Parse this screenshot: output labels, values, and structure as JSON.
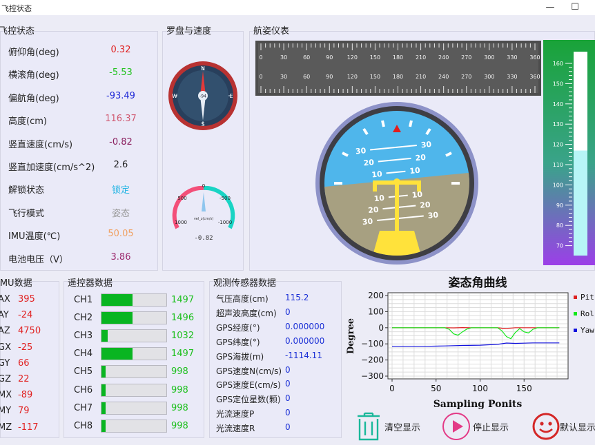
{
  "window": {
    "title": "飞控状态",
    "min_glyph": "—",
    "max_glyph": "☐"
  },
  "status": {
    "title": "飞控状态",
    "items": [
      {
        "label": "俯仰角(deg)",
        "value": "0.32",
        "color": "#e02020"
      },
      {
        "label": "横滚角(deg)",
        "value": "-5.53",
        "color": "#22c21f"
      },
      {
        "label": "偏航角(deg)",
        "value": "-93.49",
        "color": "#1d27d6"
      },
      {
        "label": "高度(cm)",
        "value": "116.37",
        "color": "#d05a72"
      },
      {
        "label": "竖直速度(cm/s)",
        "value": "-0.82",
        "color": "#8a1f5e"
      },
      {
        "label": "竖直加速度(cm/s^2)",
        "value": "2.6",
        "color": "#222222"
      },
      {
        "label": "解锁状态",
        "value": "锁定",
        "color": "#2ab6e4"
      },
      {
        "label": "飞行模式",
        "value": "姿态",
        "color": "#9a9a9a"
      },
      {
        "label": "IMU温度(℃)",
        "value": "50.05",
        "color": "#f0a060"
      },
      {
        "label": "电池电压（V）",
        "value": "3.86",
        "color": "#9c2a6e"
      }
    ]
  },
  "compass": {
    "title": "罗盘与速度",
    "letters": {
      "n": "N",
      "e": "E",
      "s": "S",
      "w": "W"
    },
    "heading": "-94",
    "speed_gauge": {
      "label": "vel_z(cm/s)",
      "ticks": [
        "0",
        "500",
        "-500",
        "1000",
        "-1000"
      ],
      "value": "-0.82"
    }
  },
  "attitude": {
    "title": "航姿仪表",
    "heading_ticks": [
      "0",
      "30",
      "60",
      "90",
      "120",
      "150",
      "180",
      "210",
      "240",
      "270",
      "300",
      "330",
      "360"
    ],
    "pitch_marks": [
      "30",
      "20",
      "10",
      "10",
      "20",
      "30"
    ],
    "altitude_ticks": [
      "160",
      "150",
      "140",
      "130",
      "120",
      "110",
      "100",
      "90",
      "80",
      "70"
    ],
    "altitude_fill": 0.515
  },
  "imu": {
    "title": "IMU数据",
    "items": [
      {
        "label": "AX",
        "value": "395"
      },
      {
        "label": "AY",
        "value": "-24"
      },
      {
        "label": "AZ",
        "value": "4750"
      },
      {
        "label": "GX",
        "value": "-25"
      },
      {
        "label": "GY",
        "value": "66"
      },
      {
        "label": "GZ",
        "value": "22"
      },
      {
        "label": "MX",
        "value": "-89"
      },
      {
        "label": "MY",
        "value": "79"
      },
      {
        "label": "MZ",
        "value": "-117"
      }
    ]
  },
  "rc": {
    "title": "遥控器数据",
    "channels": [
      {
        "label": "CH1",
        "value": "1497",
        "fill": 0.48
      },
      {
        "label": "CH2",
        "value": "1496",
        "fill": 0.48
      },
      {
        "label": "CH3",
        "value": "1032",
        "fill": 0.1
      },
      {
        "label": "CH4",
        "value": "1497",
        "fill": 0.48
      },
      {
        "label": "CH5",
        "value": "998",
        "fill": 0.06
      },
      {
        "label": "CH6",
        "value": "998",
        "fill": 0.06
      },
      {
        "label": "CH7",
        "value": "998",
        "fill": 0.06
      },
      {
        "label": "CH8",
        "value": "998",
        "fill": 0.06
      }
    ]
  },
  "sensor": {
    "title": "观测传感器数据",
    "items": [
      {
        "label": "气压高度(cm)",
        "value": "115.2"
      },
      {
        "label": "超声波高度(cm)",
        "value": "0"
      },
      {
        "label": "GPS经度(°)",
        "value": "0.000000"
      },
      {
        "label": "GPS纬度(°)",
        "value": "0.000000"
      },
      {
        "label": "GPS海拔(m)",
        "value": "-1114.11"
      },
      {
        "label": "GPS速度N(cm/s)",
        "value": "0"
      },
      {
        "label": "GPS速度E(cm/s)",
        "value": "0"
      },
      {
        "label": "GPS定位星数(颗)",
        "value": "0"
      },
      {
        "label": "光流速度P",
        "value": "0"
      },
      {
        "label": "光流速度R",
        "value": "0"
      }
    ]
  },
  "chart_data": {
    "type": "line",
    "title": "姿态角曲线",
    "xlabel": "Sampling Ponits",
    "ylabel": "Degree",
    "xlim": [
      0,
      200
    ],
    "ylim": [
      -300,
      200
    ],
    "xticks": [
      "0",
      "50",
      "100",
      "150"
    ],
    "yticks": [
      "200",
      "100",
      "0",
      "−100",
      "−200",
      "−300"
    ],
    "grid": true,
    "legend_position": "right",
    "series": [
      {
        "name": "Pitch",
        "legend": "Pit",
        "color": "#dd2020",
        "x": [
          0,
          60,
          70,
          80,
          90,
          110,
          120,
          125,
          130,
          135,
          140,
          150,
          160,
          190
        ],
        "values": [
          0,
          0,
          -1,
          1,
          0,
          0,
          0,
          -3,
          -4,
          -2,
          0,
          0,
          0,
          0
        ]
      },
      {
        "name": "Roll",
        "legend": "Rol",
        "color": "#12e81a",
        "x": [
          0,
          60,
          65,
          70,
          75,
          80,
          85,
          90,
          110,
          120,
          125,
          130,
          135,
          140,
          145,
          150,
          155,
          160,
          165,
          190
        ],
        "values": [
          0,
          0,
          -10,
          -38,
          -46,
          -25,
          -8,
          0,
          0,
          0,
          -20,
          -55,
          -68,
          -30,
          -5,
          -25,
          -32,
          -10,
          0,
          0
        ]
      },
      {
        "name": "Yaw",
        "legend": "Yaw",
        "color": "#1010dd",
        "x": [
          0,
          40,
          60,
          80,
          100,
          120,
          130,
          140,
          160,
          190
        ],
        "values": [
          -115,
          -115,
          -113,
          -110,
          -108,
          -103,
          -95,
          -97,
          -94,
          -94
        ]
      }
    ]
  },
  "buttons": {
    "clear": "清空显示",
    "stop": "停止显示",
    "reset": "默认显示"
  }
}
